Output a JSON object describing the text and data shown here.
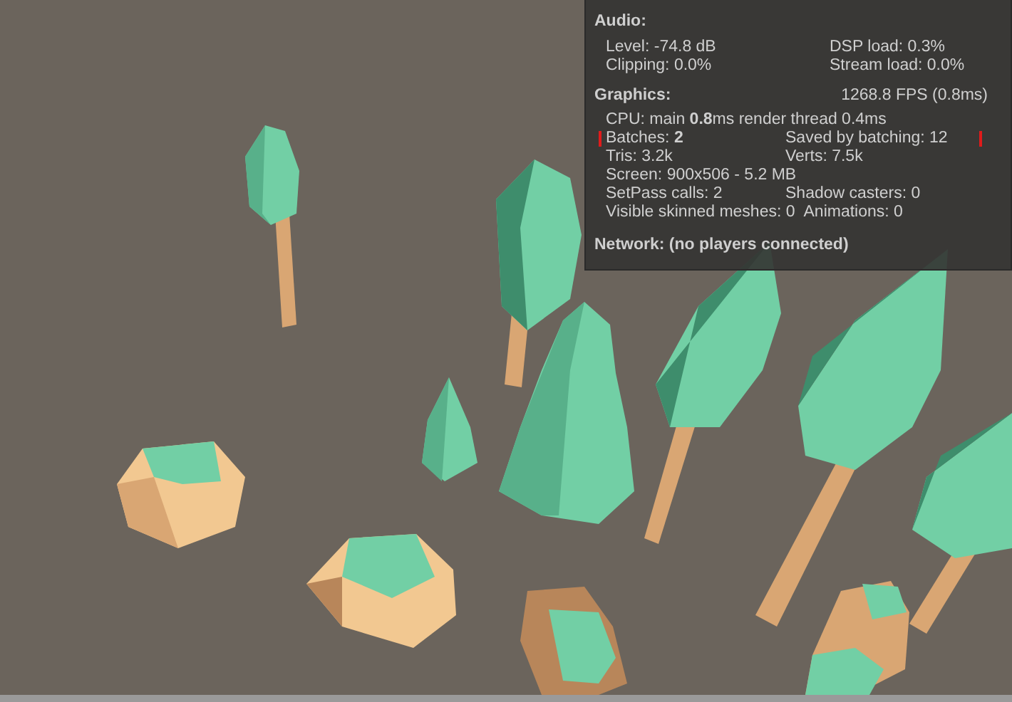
{
  "statistics": {
    "audio": {
      "title": "Audio:",
      "rows": [
        [
          "Level: -74.8 dB",
          "DSP load: 0.3%"
        ],
        [
          "Clipping: 0.0%",
          "Stream load: 0.0%"
        ]
      ]
    },
    "graphics": {
      "title": "Graphics:",
      "fps": "1268.8 FPS (0.8ms)",
      "rows": [
        {
          "kind": "line",
          "cells": [
            "CPU: main **0.8**ms  render thread 0.4ms"
          ]
        },
        {
          "kind": "marked",
          "cells": [
            "Batches: **2**",
            "Saved by batching: 12"
          ]
        },
        {
          "kind": "pair",
          "cells": [
            "Tris: 3.2k",
            "Verts: 7.5k"
          ]
        },
        {
          "kind": "line",
          "cells": [
            "Screen: 900x506 - 5.2 MB"
          ]
        },
        {
          "kind": "pair",
          "cells": [
            "SetPass calls: 2",
            "Shadow casters: 0"
          ]
        },
        {
          "kind": "pair",
          "cells": [
            "Visible skinned meshes: 0",
            "Animations: 0"
          ]
        }
      ]
    },
    "network": {
      "title": "Network: (no players connected)"
    }
  }
}
